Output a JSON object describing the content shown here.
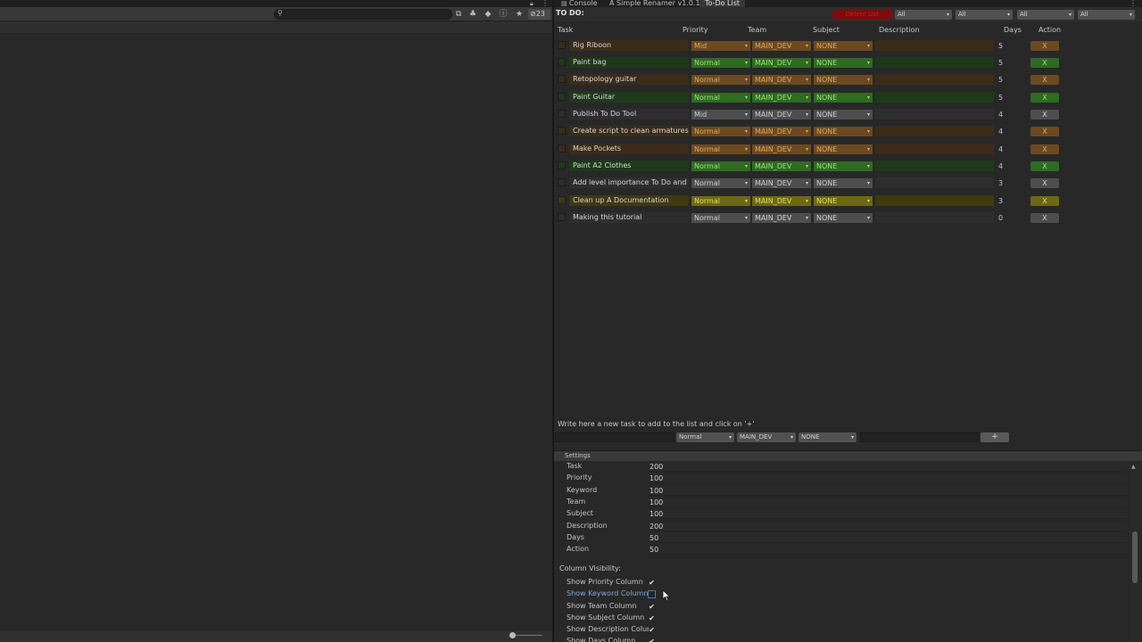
{
  "left_panel": {
    "search_placeholder": "",
    "hidden_count": "23",
    "icons": [
      "lock-icon",
      "more-icon",
      "search-icon",
      "scene-icon",
      "layers-icon",
      "tag-icon",
      "info-icon",
      "star-icon",
      "eye-off-icon"
    ]
  },
  "tabs": [
    {
      "label": "Console",
      "active": false
    },
    {
      "label": "A Simple Renamer v1.0.1",
      "active": false
    },
    {
      "label": "To-Do List",
      "active": true
    }
  ],
  "header": {
    "title": "TO DO:",
    "delete_all": "Delete List",
    "filters": [
      "All",
      "All",
      "All",
      "All"
    ]
  },
  "columns": [
    "Task",
    "Priority",
    "Team",
    "Subject",
    "Description",
    "Days",
    "Action"
  ],
  "colors": {
    "brown": "#3b2c19",
    "brown_dd": "#6b4a22",
    "brown_text": "#e0a85a",
    "green": "#1e3a1a",
    "green_dd": "#2f6b22",
    "green_text": "#9de07a",
    "gray": "#2e2e2e",
    "gray_dd": "#4e4e4e",
    "gray_text": "#cfcfcf",
    "yellow": "#3e3a12",
    "yellow_dd": "#6d6818",
    "yellow_text": "#e6dc6a"
  },
  "tasks": [
    {
      "task": "Rig Riboon",
      "priority": "Mid",
      "team": "MAIN_DEV",
      "subject": "NONE",
      "description": "",
      "days": "5",
      "action": "X",
      "tone": "brown"
    },
    {
      "task": "Paint bag",
      "priority": "Normal",
      "team": "MAIN_DEV",
      "subject": "NONE",
      "description": "",
      "days": "5",
      "action": "X",
      "tone": "green"
    },
    {
      "task": "Retopology guitar",
      "priority": "Normal",
      "team": "MAIN_DEV",
      "subject": "NONE",
      "description": "",
      "days": "5",
      "action": "X",
      "tone": "brown"
    },
    {
      "task": "Paint Guitar",
      "priority": "Normal",
      "team": "MAIN_DEV",
      "subject": "NONE",
      "description": "",
      "days": "5",
      "action": "X",
      "tone": "green"
    },
    {
      "task": "Publish To Do Tool",
      "priority": "Mid",
      "team": "MAIN_DEV",
      "subject": "NONE",
      "description": "",
      "days": "4",
      "action": "X",
      "tone": "gray"
    },
    {
      "task": "Create script to clean armatures",
      "priority": "Normal",
      "team": "MAIN_DEV",
      "subject": "NONE",
      "description": "",
      "days": "4",
      "action": "X",
      "tone": "brown"
    },
    {
      "task": "Make Pockets",
      "priority": "Normal",
      "team": "MAIN_DEV",
      "subject": "NONE",
      "description": "",
      "days": "4",
      "action": "X",
      "tone": "brown"
    },
    {
      "task": "Paint A2 Clothes",
      "priority": "Normal",
      "team": "MAIN_DEV",
      "subject": "NONE",
      "description": "",
      "days": "4",
      "action": "X",
      "tone": "green"
    },
    {
      "task": "Add level importance To Do and Edit",
      "priority": "Normal",
      "team": "MAIN_DEV",
      "subject": "NONE",
      "description": "",
      "days": "3",
      "action": "X",
      "tone": "gray"
    },
    {
      "task": "Clean up A Documentation",
      "priority": "Normal",
      "team": "MAIN_DEV",
      "subject": "NONE",
      "description": "",
      "days": "3",
      "action": "X",
      "tone": "yellow"
    },
    {
      "task": "Making this tutorial",
      "priority": "Normal",
      "team": "MAIN_DEV",
      "subject": "NONE",
      "description": "",
      "days": "0",
      "action": "X",
      "tone": "gray"
    }
  ],
  "add_task": {
    "hint": "Write here a new task to add to the list and click on '+'",
    "task_value": "",
    "priority": "Normal",
    "team": "MAIN_DEV",
    "subject": "NONE",
    "description_value": "",
    "add_label": "+"
  },
  "settings": {
    "title": "Settings",
    "widths": [
      {
        "label": "Task",
        "value": "200"
      },
      {
        "label": "Priority",
        "value": "100"
      },
      {
        "label": "Keyword",
        "value": "100"
      },
      {
        "label": "Team",
        "value": "100"
      },
      {
        "label": "Subject",
        "value": "100"
      },
      {
        "label": "Description",
        "value": "200"
      },
      {
        "label": "Days",
        "value": "50"
      },
      {
        "label": "Action",
        "value": "50"
      }
    ],
    "visibility_title": "Column Visibility:",
    "visibility": [
      {
        "label": "Show Priority Column",
        "checked": true
      },
      {
        "label": "Show Keyword Column",
        "checked": false
      },
      {
        "label": "Show Team Column",
        "checked": true
      },
      {
        "label": "Show Subject Column",
        "checked": true
      },
      {
        "label": "Show Description Column",
        "checked": true
      },
      {
        "label": "Show Days Column",
        "checked": true
      }
    ]
  }
}
